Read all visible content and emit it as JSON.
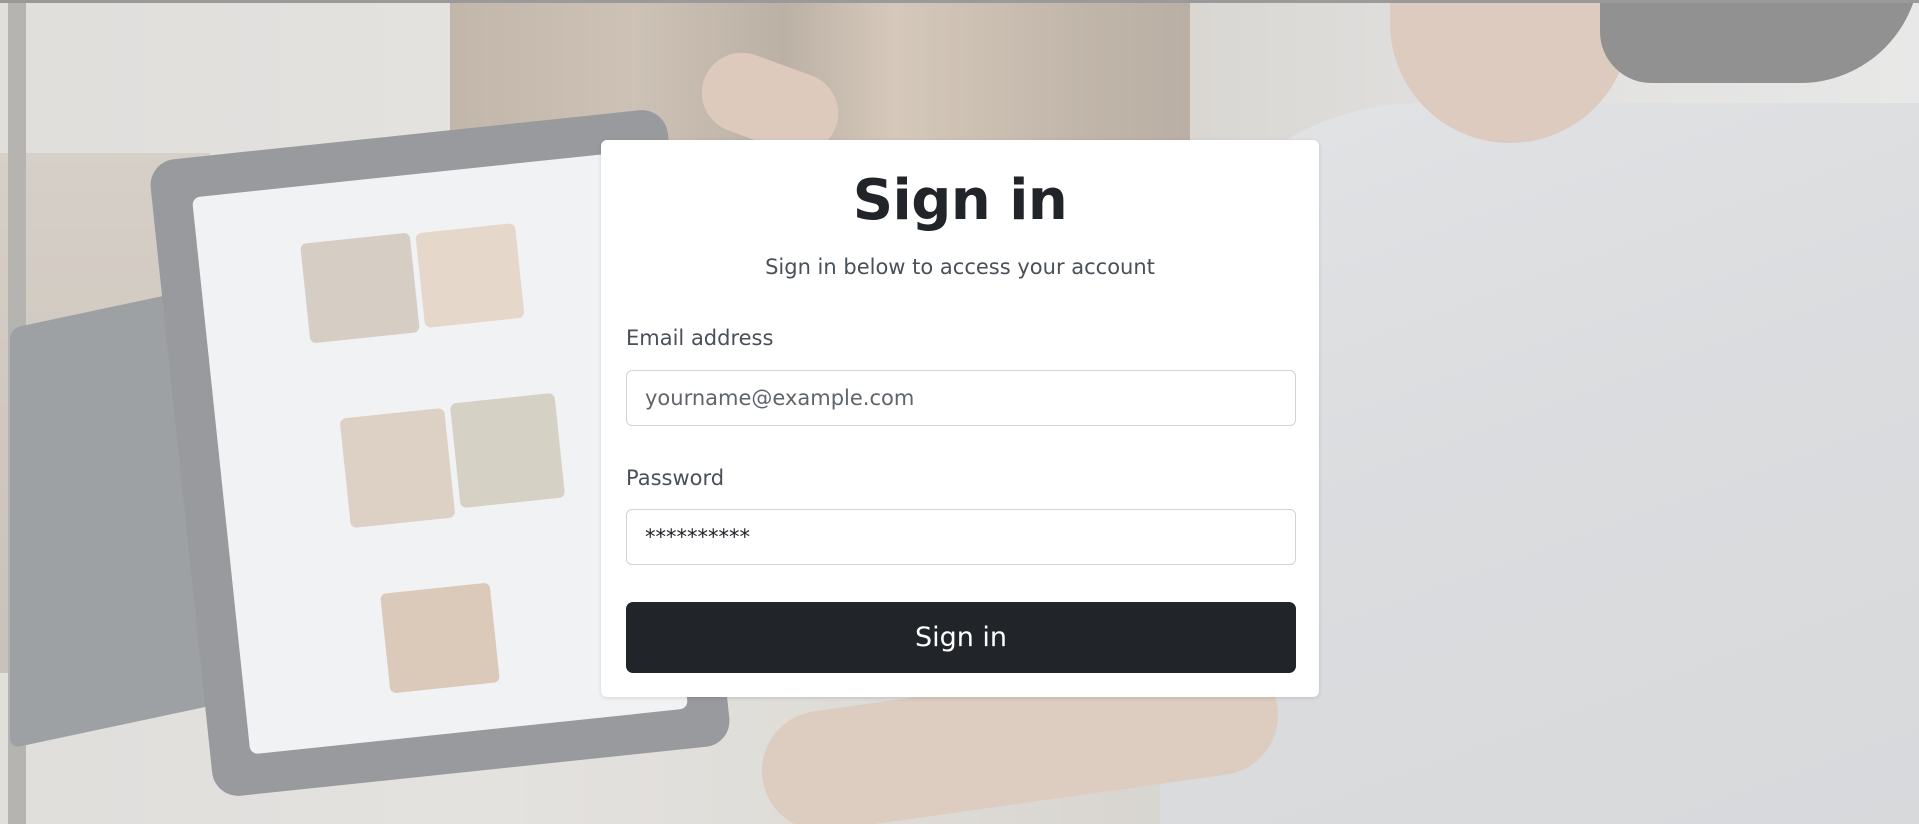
{
  "signin": {
    "title": "Sign in",
    "subtitle": "Sign in below to access your account",
    "email_label": "Email address",
    "email_placeholder": "yourname@example.com",
    "password_label": "Password",
    "password_value": "**********",
    "submit_label": "Sign in"
  },
  "colors": {
    "button": "#212529",
    "card": "#ffffff",
    "text": "#212529"
  }
}
